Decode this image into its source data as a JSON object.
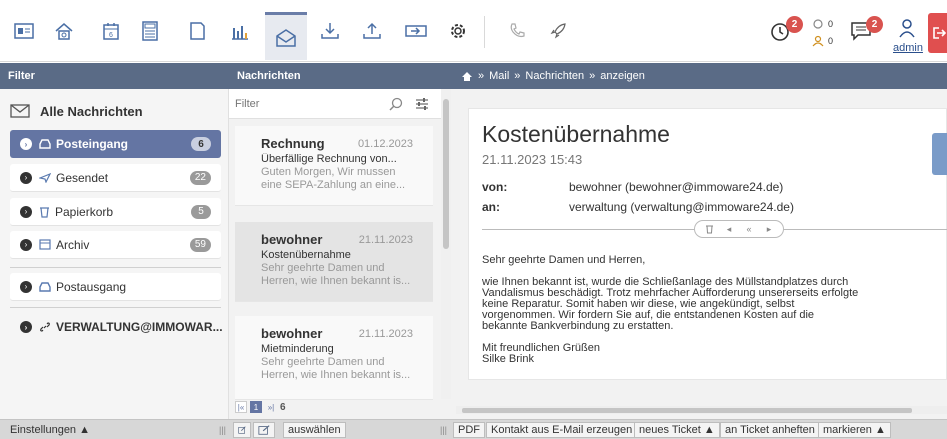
{
  "toolbar": {
    "buttons": [
      {
        "name": "contacts-card-icon"
      },
      {
        "name": "home-icon"
      },
      {
        "name": "calendar-icon",
        "label": "6"
      },
      {
        "name": "calculator-icon"
      },
      {
        "name": "documents-icon"
      },
      {
        "name": "statistics-icon"
      },
      {
        "name": "mail-icon",
        "active": true
      },
      {
        "name": "download-icon"
      },
      {
        "name": "upload-icon"
      },
      {
        "name": "import-icon"
      },
      {
        "name": "settings-icon"
      },
      {
        "name": "phone-icon"
      },
      {
        "name": "rocket-icon"
      }
    ],
    "clock_badge": "2",
    "mini_counts": [
      "0",
      "0"
    ],
    "messages_badge": "2",
    "user_name": "admin",
    "accent": "#6475a3",
    "badge_color": "#d9534f",
    "logout_color": "#e04f4f"
  },
  "headers": {
    "filter": "Filter",
    "messages": "Nachrichten"
  },
  "breadcrumb": {
    "items": [
      "Mail",
      "Nachrichten",
      "anzeigen"
    ],
    "separator": "»"
  },
  "filter": {
    "all_label": "Alle Nachrichten",
    "folders": [
      {
        "label": "Posteingang",
        "count": "6",
        "icon": "inbox-icon",
        "active": true
      },
      {
        "label": "Gesendet",
        "count": "22",
        "icon": "send-icon"
      },
      {
        "label": "Papierkorb",
        "count": "5",
        "icon": "trash-icon"
      },
      {
        "label": "Archiv",
        "count": "59",
        "icon": "archive-icon"
      }
    ],
    "outbox_label": "Postausgang",
    "account_label": "VERWALTUNG@IMMOWAR..."
  },
  "messages": {
    "filter_placeholder": "Filter",
    "items": [
      {
        "sender": "Rechnung",
        "date": "01.12.2023",
        "subject": "Überfällige Rechnung von...",
        "preview": "Guten Morgen, Wir mussen eine SEPA-Zahlung an eine..."
      },
      {
        "sender": "bewohner",
        "date": "21.11.2023",
        "subject": "Kostenübernahme",
        "preview": "Sehr geehrte Damen und Herren, wie Ihnen bekannt is...",
        "active": true
      },
      {
        "sender": "bewohner",
        "date": "21.11.2023",
        "subject": "Mietminderung",
        "preview": "Sehr geehrte Damen und Herren, wie Ihnen bekannt is..."
      }
    ],
    "pager": {
      "first": "|«",
      "current": "1",
      "last": "»|",
      "total": "6"
    }
  },
  "mail": {
    "subject": "Kostenübernahme",
    "datetime": "21.11.2023 15:43",
    "from_label": "von:",
    "from_value": "bewohner (bewohner@immoware24.de)",
    "to_label": "an:",
    "to_value": "verwaltung (verwaltung@immoware24.de)",
    "body": [
      "Sehr geehrte Damen und Herren,",
      "wie Ihnen bekannt ist, wurde die Schließanlage des Müllstandplatzes durch Vandalismus beschädigt. Trotz mehrfacher Aufforderung unsererseits erfolgte keine Reparatur. Somit haben wir diese, wie angekündigt, selbst vorgenommen. Wir fordern Sie auf, die entstandenen Kosten auf die bekannte Bankverbindung zu erstatten.",
      "Mit freundlichen Grüßen\nSilke Brink"
    ]
  },
  "bottom_bar": {
    "settings": "Einstellungen ▲",
    "select": "auswählen",
    "pdf": "PDF",
    "contact": "Kontakt aus E-Mail erzeugen",
    "new_ticket": "neues Ticket ▲",
    "attach_ticket": "an Ticket anheften",
    "mark": "markieren ▲"
  }
}
